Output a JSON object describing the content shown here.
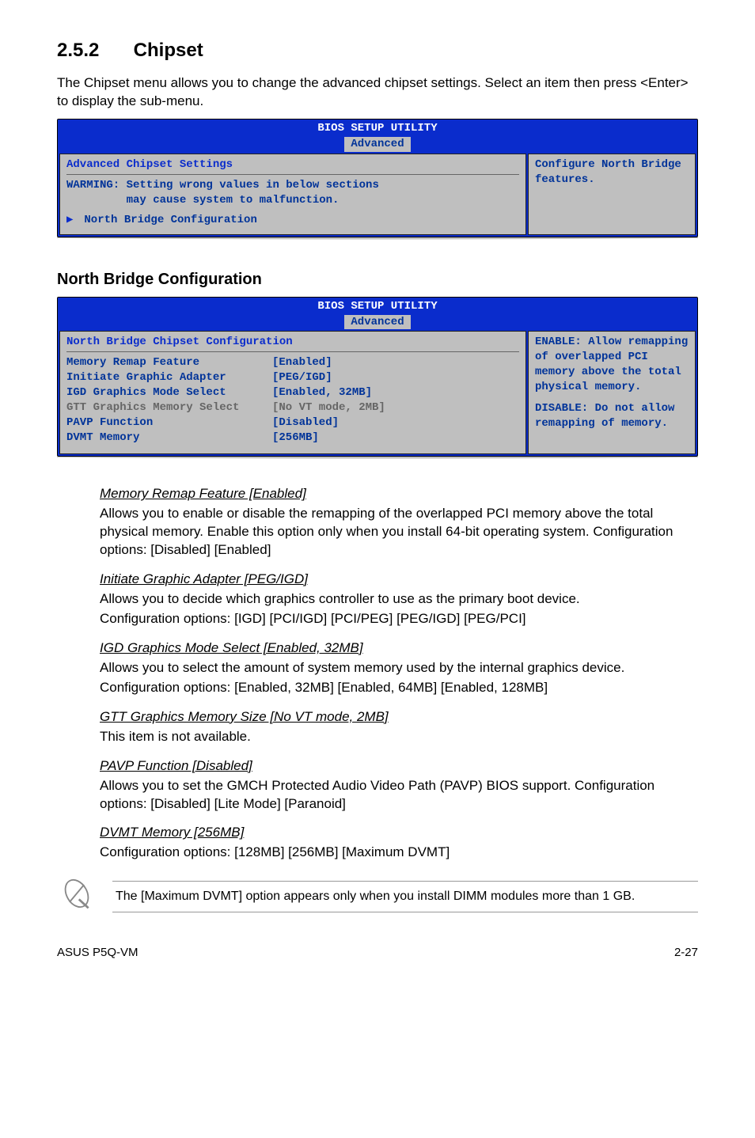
{
  "section": {
    "number": "2.5.2",
    "title": "Chipset"
  },
  "intro": "The Chipset menu allows you to change the advanced chipset settings. Select an item then press <Enter> to display the sub-menu.",
  "bios1": {
    "setup_title": "BIOS SETUP UTILITY",
    "tab": "Advanced",
    "left_heading": "Advanced Chipset Settings",
    "warning_l1": "WARMING: Setting wrong values in below sections",
    "warning_l2": "         may cause system to malfunction.",
    "item": "North Bridge Configuration",
    "right": "Configure North Bridge features."
  },
  "sub_heading": "North Bridge Configuration",
  "bios2": {
    "setup_title": "BIOS SETUP UTILITY",
    "tab": "Advanced",
    "left_heading": "North Bridge Chipset Configuration",
    "rows": [
      {
        "label": "Memory Remap Feature",
        "value": "[Enabled]"
      },
      {
        "label": "",
        "value": ""
      },
      {
        "label": "Initiate Graphic Adapter",
        "value": "[PEG/IGD]"
      },
      {
        "label": "IGD Graphics Mode Select",
        "value": "[Enabled, 32MB]"
      },
      {
        "label": "GTT Graphics Memory Select",
        "value": "[No VT mode, 2MB]",
        "gray": true
      },
      {
        "label": "PAVP Function",
        "value": "[Disabled]"
      },
      {
        "label": "",
        "value": ""
      },
      {
        "label": "DVMT Memory",
        "value": "[256MB]"
      }
    ],
    "right_l1": "ENABLE: Allow remapping of overlapped PCI memory above the total physical memory.",
    "right_l2": "DISABLE: Do not allow remapping of memory."
  },
  "items": {
    "memory_remap": {
      "title": "Memory Remap Feature [Enabled]",
      "desc1": "Allows you to enable or disable the remapping of the overlapped PCI memory above the total physical memory. Enable this option only when you install 64-bit operating system. Configuration options: [Disabled] [Enabled]"
    },
    "initiate_graphic": {
      "title": "Initiate Graphic Adapter [PEG/IGD]",
      "desc1": "Allows you to decide which graphics controller to use as the primary boot device.",
      "desc2": "Configuration options: [IGD] [PCI/IGD] [PCI/PEG] [PEG/IGD] [PEG/PCI]"
    },
    "igd_mode": {
      "title": "IGD Graphics Mode Select [Enabled, 32MB]",
      "desc1": "Allows you to select the amount of system memory used by the internal graphics device.",
      "desc2": "Configuration options: [Enabled, 32MB] [Enabled, 64MB] [Enabled, 128MB]"
    },
    "gtt": {
      "title": "GTT Graphics Memory Size [No VT mode, 2MB]",
      "desc1": "This item is not available."
    },
    "pavp": {
      "title": "PAVP Function [Disabled]",
      "desc1": "Allows you to set the GMCH Protected Audio Video Path (PAVP) BIOS support. Configuration options: [Disabled] [Lite Mode] [Paranoid]"
    },
    "dvmt": {
      "title": "DVMT Memory [256MB]",
      "desc1": "Configuration options: [128MB] [256MB] [Maximum DVMT]"
    }
  },
  "note": "The [Maximum DVMT] option appears only when you install DIMM modules more than 1 GB.",
  "footer": {
    "left": "ASUS P5Q-VM",
    "right": "2-27"
  }
}
